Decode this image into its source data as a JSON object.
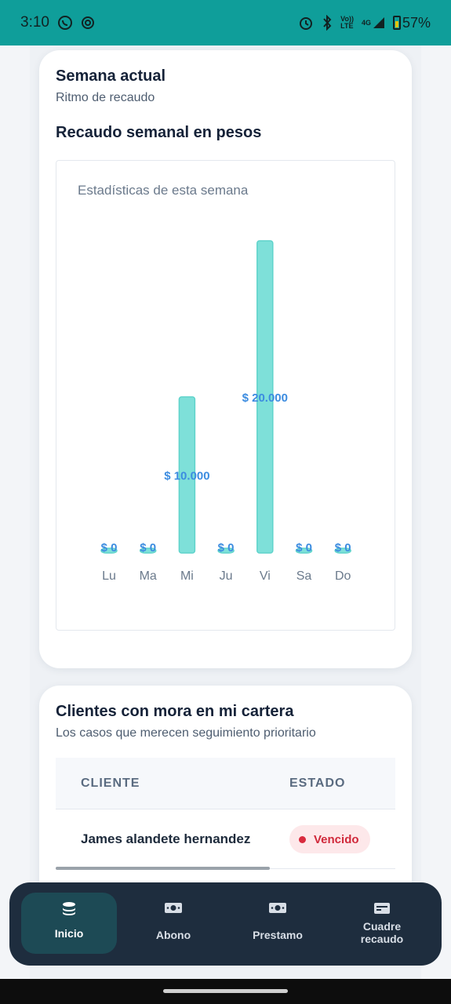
{
  "status_bar": {
    "time": "3:10",
    "net_top": "Vo))",
    "net_bottom": "LTE",
    "network": "4G",
    "battery": "57%"
  },
  "week_card": {
    "title": "Semana actual",
    "subtitle": "Ritmo de recaudo",
    "section_title": "Recaudo semanal en pesos"
  },
  "chart_data": {
    "type": "bar",
    "title": "Estadísticas de esta semana",
    "categories": [
      "Lu",
      "Ma",
      "Mi",
      "Ju",
      "Vi",
      "Sa",
      "Do"
    ],
    "values": [
      0,
      0,
      10000,
      0,
      20000,
      0,
      0
    ],
    "labels": [
      "$ 0",
      "$ 0",
      "$ 10.000",
      "$ 0",
      "$ 20.000",
      "$ 0",
      "$ 0"
    ],
    "ylim": [
      0,
      20000
    ],
    "bar_color": "#7ee0d9",
    "bar_border": "#5fd3cb",
    "label_color": "#3c8ce0",
    "grid": false
  },
  "mora_card": {
    "title": "Clientes con mora en mi cartera",
    "subtitle": "Los casos que merecen seguimiento prioritario",
    "columns": [
      "CLIENTE",
      "ESTADO"
    ],
    "rows": [
      {
        "cliente": "James alandete hernandez",
        "estado": "Vencido"
      }
    ]
  },
  "bottom_nav": {
    "items": [
      {
        "label": "Inicio",
        "icon": "coins-icon",
        "active": true
      },
      {
        "label": "Abono",
        "icon": "cash-icon",
        "active": false
      },
      {
        "label": "Prestamo",
        "icon": "cash-icon",
        "active": false
      },
      {
        "label_line1": "Cuadre",
        "label_line2": "recaudo",
        "icon": "card-icon",
        "active": false
      }
    ]
  }
}
